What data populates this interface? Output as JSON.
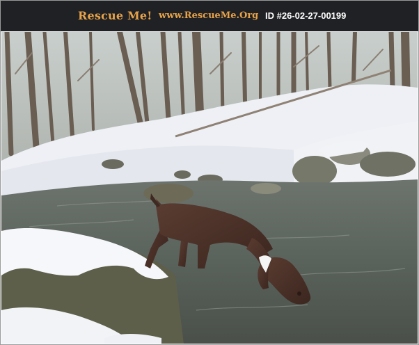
{
  "header": {
    "brand": "Rescue Me!",
    "site": "www.RescueMe.Org",
    "listing_id": "ID #26-02-27-00199"
  },
  "photo": {
    "subject": "dog-in-creek-icon"
  },
  "colors": {
    "header_bg": "#202124",
    "brand_orange": "#e7a34a",
    "id_text": "#ffffff",
    "dog_brown": "#4a3128",
    "water": "#5d6560",
    "snow": "#f4f5f8"
  }
}
